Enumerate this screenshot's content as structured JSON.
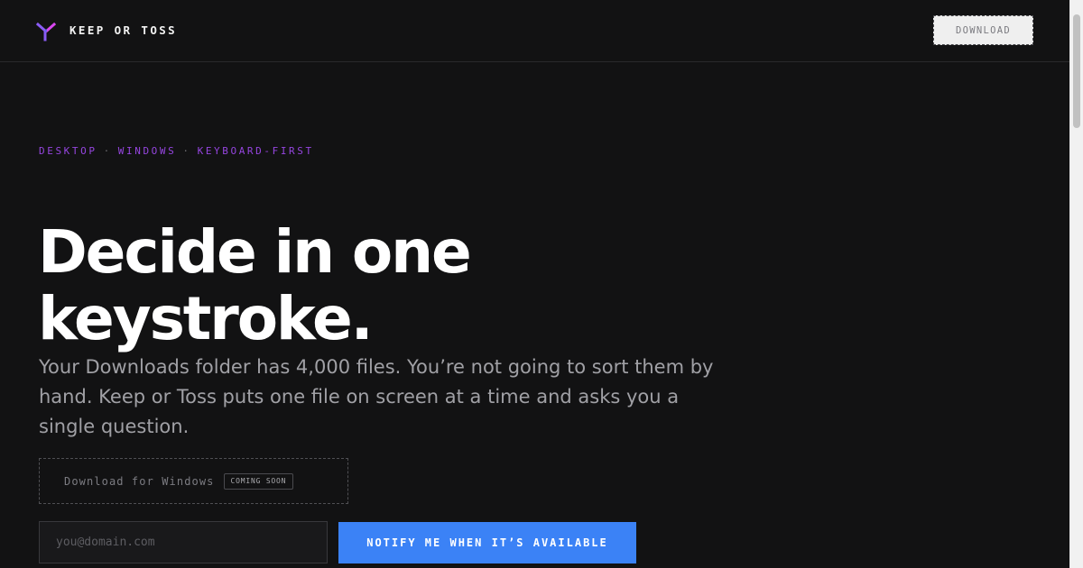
{
  "header": {
    "brand": "KEEP OR TOSS",
    "download_label": "DOWNLOAD",
    "logo_icon": "branching-y-logo-icon"
  },
  "hero": {
    "tags": [
      "DESKTOP",
      "WINDOWS",
      "KEYBOARD-FIRST"
    ],
    "separator": "·",
    "title_line1": "Decide in one",
    "title_line2": "keystroke.",
    "description": "Your Downloads folder has 4,000 files. You’re not going to sort them by hand. Keep or Toss puts one file on screen at a time and asks you a single question."
  },
  "download_windows": {
    "label": "Download for Windows",
    "badge": "COMING SOON"
  },
  "notify": {
    "email_placeholder": "you@domain.com",
    "email_value": "",
    "button_label": "NOTIFY ME WHEN IT’S AVAILABLE"
  },
  "colors": {
    "background": "#121213",
    "accent_purple": "#9545df",
    "accent_blue": "#3b82f6",
    "text_primary": "#ffffff",
    "text_secondary": "#a0a0a5"
  }
}
